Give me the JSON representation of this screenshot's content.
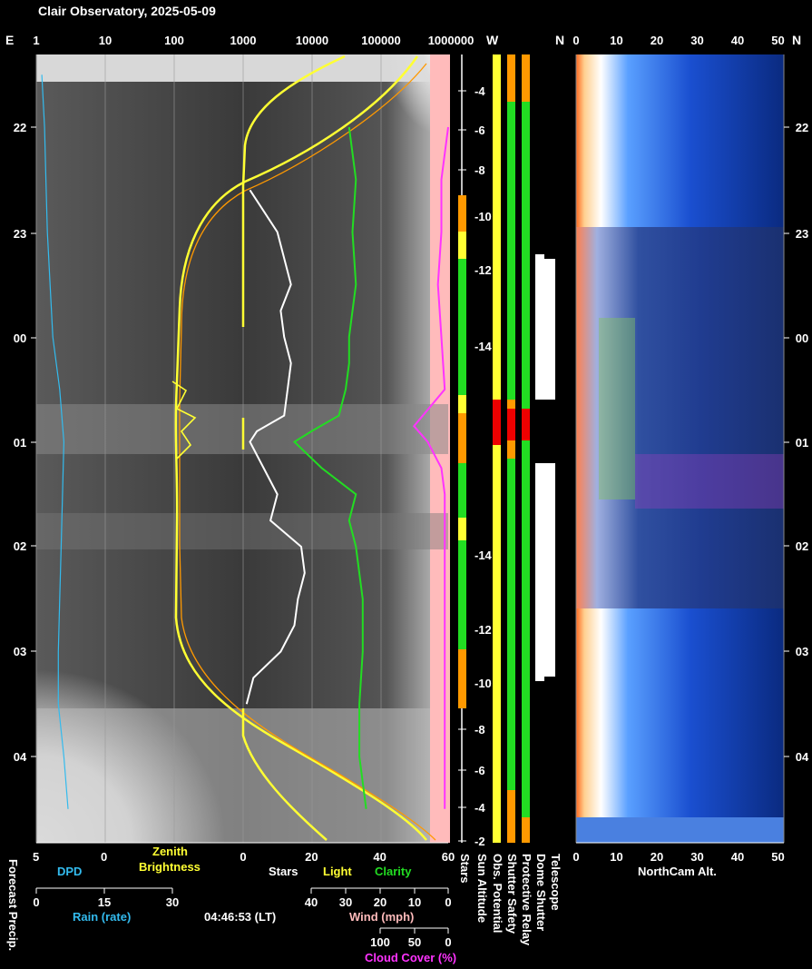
{
  "title": "Clair Observatory, 2025-05-09",
  "timestamp": "04:46:53 (LT)",
  "colors": {
    "yellow": "#ffff33",
    "orange": "#ff9900",
    "green": "#22dd22",
    "magenta": "#ff33ff",
    "cyan": "#33bbee",
    "pink": "#ffbbbb",
    "white": "#ffffff",
    "red": "#ee0000",
    "blue_sky": "#1040a0"
  },
  "left_top": {
    "compass": "E",
    "brightness_ticks": [
      "1",
      "10",
      "100",
      "1000",
      "10000",
      "100000",
      "1000000"
    ]
  },
  "status_top": {
    "w": "W",
    "n": "N"
  },
  "right_top": {
    "ticks": [
      "0",
      "10",
      "20",
      "30",
      "40",
      "50"
    ],
    "compass": "N"
  },
  "time_ticks": [
    "22",
    "23",
    "00",
    "01",
    "02",
    "03",
    "04"
  ],
  "sun_altitude_ticks": [
    "-4",
    "-6",
    "-8",
    "-10",
    "-12",
    "-14",
    "-14",
    "-12",
    "-10",
    "-8",
    "-6",
    "-4",
    "-2"
  ],
  "bottom": {
    "dpd_scale": [
      "5",
      "0"
    ],
    "dpd_label": "DPD",
    "zenith_label_1": "Zenith",
    "zenith_label_2": "Brightness",
    "clarity_scale": [
      "0",
      "20",
      "40",
      "60"
    ],
    "stars_label": "Stars",
    "light_label": "Light",
    "clarity_label": "Clarity",
    "rain_scale": [
      "0",
      "15",
      "30"
    ],
    "rain_label": "Rain (rate)",
    "wind_scale": [
      "40",
      "30",
      "20",
      "10",
      "0"
    ],
    "wind_label": "Wind (mph)",
    "cloud_scale": [
      "100",
      "50",
      "0"
    ],
    "cloud_label": "Cloud Cover (%)",
    "forecast_label": "Forecast Precip.",
    "northcam_scale": [
      "0",
      "10",
      "20",
      "30",
      "40",
      "50"
    ],
    "northcam_label": "NorthCam Alt."
  },
  "vertical_labels": [
    "Stars",
    "Sun Altitude",
    "Obs. Potential",
    "Shutter Safety",
    "Protective Relay",
    "Dome Shutter",
    "Telescope"
  ],
  "chart_data": {
    "type": "line",
    "x_axis": "local time",
    "time_ticks": [
      "22",
      "23",
      "00",
      "01",
      "02",
      "03",
      "04"
    ],
    "x_scale_log_brightness": [
      1,
      1000000
    ],
    "x_scale_clarity": [
      0,
      60
    ],
    "series": [
      {
        "name": "Clarity",
        "color": "green",
        "values": [
          [
            22.0,
            31
          ],
          [
            22.5,
            33
          ],
          [
            23.0,
            32
          ],
          [
            23.5,
            33
          ],
          [
            0.0,
            31
          ],
          [
            0.25,
            31
          ],
          [
            0.5,
            30
          ],
          [
            0.75,
            28
          ],
          [
            0.9,
            20
          ],
          [
            1.0,
            15
          ],
          [
            1.25,
            23
          ],
          [
            1.5,
            33
          ],
          [
            1.75,
            31
          ],
          [
            2.0,
            33
          ],
          [
            2.5,
            35
          ],
          [
            3.0,
            35
          ],
          [
            3.5,
            34
          ],
          [
            4.0,
            34
          ],
          [
            4.5,
            36
          ]
        ]
      },
      {
        "name": "Stars",
        "color": "white",
        "values": [
          [
            22.6,
            2
          ],
          [
            22.75,
            5
          ],
          [
            23.0,
            10
          ],
          [
            23.25,
            12
          ],
          [
            23.5,
            14
          ],
          [
            23.75,
            11
          ],
          [
            0.0,
            12
          ],
          [
            0.25,
            14
          ],
          [
            0.5,
            13
          ],
          [
            0.75,
            12
          ],
          [
            0.9,
            4
          ],
          [
            1.0,
            2
          ],
          [
            1.25,
            6
          ],
          [
            1.5,
            10
          ],
          [
            1.75,
            8
          ],
          [
            2.0,
            17
          ],
          [
            2.25,
            18
          ],
          [
            2.5,
            16
          ],
          [
            2.75,
            15
          ],
          [
            3.0,
            11
          ],
          [
            3.25,
            3
          ],
          [
            3.5,
            1
          ]
        ]
      },
      {
        "name": "Cloud Cover",
        "color": "magenta",
        "values": [
          [
            22.0,
            60
          ],
          [
            22.5,
            58
          ],
          [
            23.0,
            58
          ],
          [
            23.5,
            57
          ],
          [
            0.0,
            58
          ],
          [
            0.5,
            59
          ],
          [
            0.85,
            50
          ],
          [
            1.0,
            54
          ],
          [
            1.25,
            58
          ],
          [
            1.5,
            59
          ],
          [
            2.0,
            59
          ],
          [
            2.5,
            59
          ],
          [
            3.0,
            59
          ],
          [
            3.5,
            59
          ],
          [
            4.0,
            59
          ],
          [
            4.5,
            59
          ]
        ]
      },
      {
        "name": "DPD",
        "color": "cyan",
        "values": [
          [
            21.5,
            4.6
          ],
          [
            22.0,
            4.4
          ],
          [
            22.5,
            4.3
          ],
          [
            23.0,
            4.2
          ],
          [
            23.5,
            4.0
          ],
          [
            0.0,
            3.8
          ],
          [
            0.5,
            3.3
          ],
          [
            1.0,
            3.0
          ],
          [
            1.5,
            3.1
          ],
          [
            2.0,
            3.2
          ],
          [
            2.5,
            3.3
          ],
          [
            3.0,
            3.4
          ],
          [
            3.5,
            3.4
          ],
          [
            4.0,
            3.0
          ],
          [
            4.5,
            2.7
          ]
        ]
      }
    ],
    "sun_altitude_ticks": [
      -4,
      -6,
      -8,
      -10,
      -12,
      -14,
      -14,
      -12,
      -10,
      -8,
      -6,
      -4,
      -2
    ],
    "northcam_axis": [
      0,
      50
    ]
  }
}
